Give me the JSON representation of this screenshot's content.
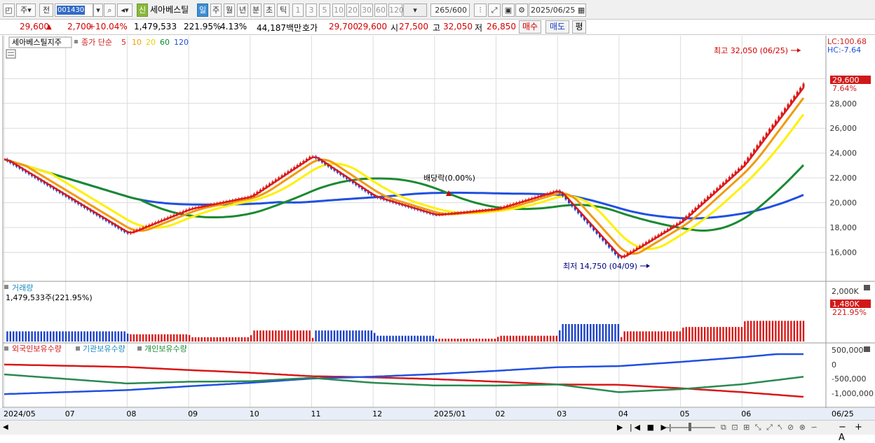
{
  "toolbar": {
    "mode_label": "주",
    "prev_label": "전",
    "stock_code": "001430",
    "new_label": "신",
    "stock_name": "세아베스틸",
    "periods": [
      "일",
      "주",
      "월",
      "년",
      "분",
      "초",
      "틱"
    ],
    "active_period": "일",
    "intervals": [
      "1",
      "3",
      "5",
      "10",
      "20",
      "30",
      "60",
      "120"
    ],
    "count": "265",
    "count_total": "/600",
    "date": "2025/06/25"
  },
  "quote": {
    "price": "29,600",
    "change": "2,700",
    "change_pct": "+10.04%",
    "volume": "1,479,533",
    "volume_ratio": "221.95%",
    "turnover": "4.13%",
    "amount": "44,187백만",
    "ask_label": "호가",
    "ask": "29,700",
    "bid": "29,600",
    "open_label": "시",
    "open": "27,500",
    "high_label": "고",
    "high": "32,050",
    "low_label": "저",
    "low": "26,850",
    "buy_label": "매수",
    "sell_label": "매도",
    "eval_label": "평"
  },
  "chart_header": {
    "title": "세아베스틸지주",
    "ma_label": "종가 단순",
    "ma_periods": [
      "5",
      "10",
      "20",
      "60",
      "120"
    ],
    "ma_colors": [
      "#e02020",
      "#f0a000",
      "#ffe000",
      "#0a8a2a",
      "#1e50e0"
    ]
  },
  "price_panel": {
    "lc": "LC:100.68",
    "hc": "HC:-7.64",
    "high_marker": "최고 32,050 (06/25)",
    "low_marker": "최저 14,750 (04/09)",
    "dividend": "배당락(0.00%)",
    "current_price_tag": "29,600",
    "current_pct_tag": "7.64%"
  },
  "volume_panel": {
    "title": "거래량",
    "value_text": "1,479,533주(221.95%)",
    "axis_labels": [
      "2,000K"
    ],
    "tag": "1,480K",
    "tag_pct": "221.95%"
  },
  "holdings_panel": {
    "legend": [
      "외국인보유수량",
      "기관보유수량",
      "개인보유수량"
    ],
    "axis_labels": [
      "500,000",
      "0",
      "-500,000",
      "-1,000,000"
    ]
  },
  "x_axis": {
    "labels": [
      "2024/05",
      "07",
      "08",
      "09",
      "10",
      "11",
      "12",
      "2025/01",
      "02",
      "03",
      "04",
      "05",
      "06"
    ],
    "right_label": "06/25"
  },
  "chart_data": {
    "type": "line",
    "y_unit": "KRW",
    "ylim": [
      14000,
      32500
    ],
    "yticks": [
      16000,
      18000,
      20000,
      22000,
      24000,
      26000,
      28000,
      30000
    ],
    "key_points": [
      {
        "date": "2024/05",
        "close": 23500
      },
      {
        "date": "2024/07",
        "close": 20500
      },
      {
        "date": "2024/08",
        "close": 17500
      },
      {
        "date": "2024/09",
        "close": 19500
      },
      {
        "date": "2024/10",
        "close": 20500
      },
      {
        "date": "2024/11",
        "close": 23800
      },
      {
        "date": "2024/12",
        "close": 20500
      },
      {
        "date": "2025/01",
        "close": 19000
      },
      {
        "date": "2025/02",
        "close": 19500
      },
      {
        "date": "2025/03",
        "close": 21000
      },
      {
        "date": "2025/04",
        "close": 15500
      },
      {
        "date": "2025/05",
        "close": 18500
      },
      {
        "date": "2025/06",
        "close": 23000
      },
      {
        "date": "2025/06/25",
        "close": 29600
      }
    ],
    "high": {
      "value": 32050,
      "date": "06/25"
    },
    "low": {
      "value": 14750,
      "date": "04/09"
    }
  },
  "statusbar": {
    "zoom_label": "A"
  }
}
